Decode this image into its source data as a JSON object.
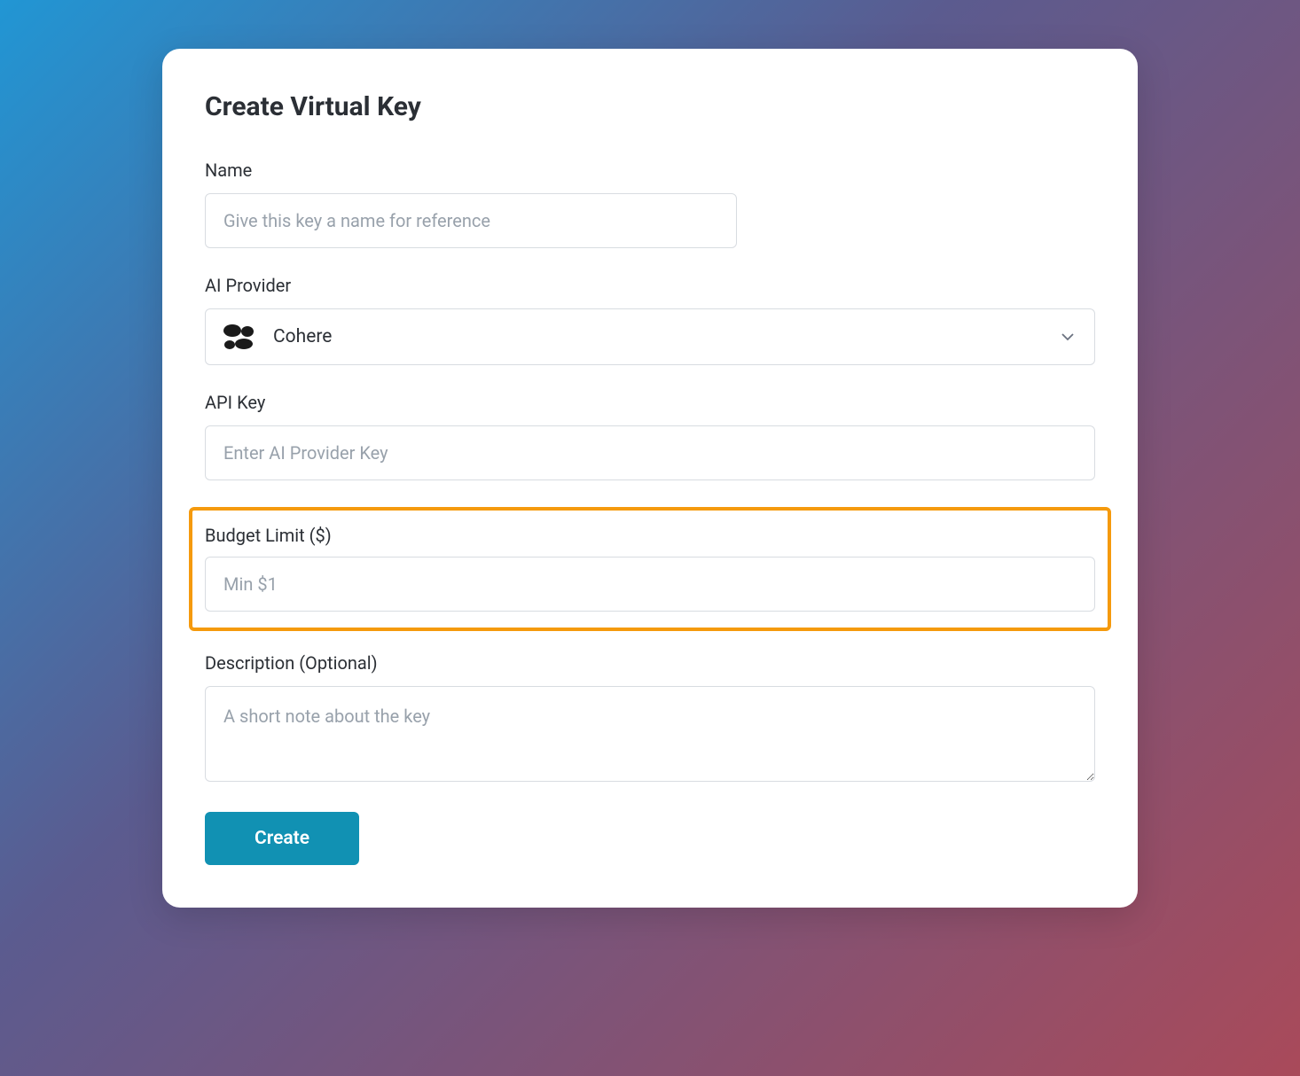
{
  "page_title": "Create Virtual Key",
  "fields": {
    "name": {
      "label": "Name",
      "placeholder": "Give this key a name for reference",
      "value": ""
    },
    "provider": {
      "label": "AI Provider",
      "selected": "Cohere",
      "icon": "cohere-icon"
    },
    "api_key": {
      "label": "API Key",
      "placeholder": "Enter AI Provider Key",
      "value": ""
    },
    "budget": {
      "label": "Budget Limit ($)",
      "placeholder": "Min $1",
      "value": ""
    },
    "description": {
      "label": "Description (Optional)",
      "placeholder": "A short note about the key",
      "value": ""
    }
  },
  "actions": {
    "create_label": "Create"
  },
  "colors": {
    "accent": "#1191b3",
    "highlight_border": "#f59a0d"
  }
}
